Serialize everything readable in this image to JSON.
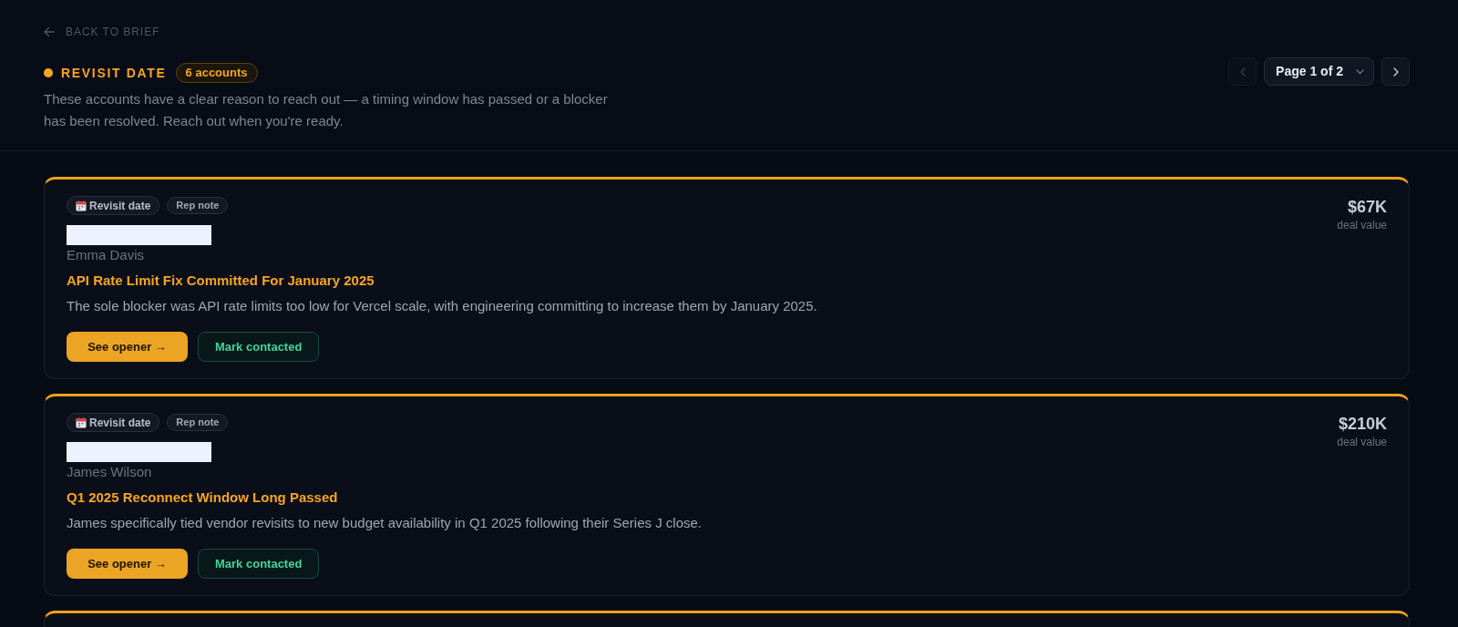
{
  "back_link": {
    "label": "BACK TO BRIEF"
  },
  "section": {
    "title": "REVISIT DATE",
    "count_badge": "6 accounts",
    "description": "These accounts have a clear reason to reach out — a timing window has passed or a blocker has been resolved. Reach out when you're ready."
  },
  "pagination": {
    "prev": {
      "disabled": true
    },
    "label": "Page 1 of 2",
    "next": {
      "disabled": false
    }
  },
  "cards": [
    {
      "kind": "full",
      "tags": [
        {
          "kind": "revisit",
          "label": "Revisit date"
        },
        {
          "kind": "note",
          "label": "Rep note"
        }
      ],
      "company_redacted": true,
      "contact": "Emma Davis",
      "headline": "API Rate Limit Fix Committed For January 2025",
      "summary": "The sole blocker was API rate limits too low for Vercel scale, with engineering committing to increase them by January 2025.",
      "deal_value": "$67K",
      "deal_value_label": "deal value",
      "actions": [
        {
          "kind": "primary",
          "label": "See opener →"
        },
        {
          "kind": "secondary",
          "label": "Mark contacted"
        }
      ]
    },
    {
      "kind": "full",
      "tags": [
        {
          "kind": "revisit",
          "label": "Revisit date"
        },
        {
          "kind": "note",
          "label": "Rep note"
        }
      ],
      "company_redacted": true,
      "contact": "James Wilson",
      "headline": "Q1 2025 Reconnect Window Long Passed",
      "summary": "James specifically tied vendor revisits to new budget availability in Q1 2025 following their Series J close.",
      "deal_value": "$210K",
      "deal_value_label": "deal value",
      "actions": [
        {
          "kind": "primary",
          "label": "See opener →"
        },
        {
          "kind": "secondary",
          "label": "Mark contacted"
        }
      ]
    },
    {
      "kind": "cut_off"
    }
  ]
}
